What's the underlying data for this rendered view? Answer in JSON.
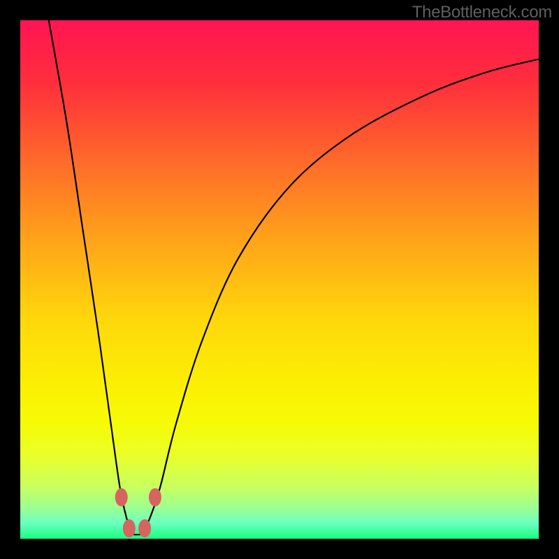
{
  "watermark": "TheBottleneck.com",
  "chart_data": {
    "type": "line",
    "title": "",
    "xlabel": "",
    "ylabel": "",
    "xlim": [
      0,
      100
    ],
    "ylim": [
      0,
      100
    ],
    "background_gradient": {
      "type": "linear-vertical",
      "stops": [
        {
          "pos": 0.0,
          "color": "#ff1553"
        },
        {
          "pos": 0.12,
          "color": "#ff2e3c"
        },
        {
          "pos": 0.28,
          "color": "#ff6d29"
        },
        {
          "pos": 0.42,
          "color": "#ffa21a"
        },
        {
          "pos": 0.58,
          "color": "#ffd80b"
        },
        {
          "pos": 0.72,
          "color": "#fbf203"
        },
        {
          "pos": 0.78,
          "color": "#f6fb06"
        },
        {
          "pos": 0.84,
          "color": "#eaff2a"
        },
        {
          "pos": 0.9,
          "color": "#c8ff60"
        },
        {
          "pos": 0.94,
          "color": "#9eff92"
        },
        {
          "pos": 0.97,
          "color": "#6affc0"
        },
        {
          "pos": 1.0,
          "color": "#18ff7e"
        }
      ]
    },
    "curve": {
      "description": "Asymmetric V-shaped bottleneck curve",
      "minimum_at_x": 22.5,
      "points": [
        {
          "x": 5.5,
          "y": 100.0
        },
        {
          "x": 9.0,
          "y": 80.0
        },
        {
          "x": 12.0,
          "y": 60.0
        },
        {
          "x": 15.0,
          "y": 40.0
        },
        {
          "x": 17.5,
          "y": 22.0
        },
        {
          "x": 19.2,
          "y": 10.0
        },
        {
          "x": 20.5,
          "y": 4.0
        },
        {
          "x": 21.5,
          "y": 1.2
        },
        {
          "x": 22.5,
          "y": 0.8
        },
        {
          "x": 23.5,
          "y": 1.2
        },
        {
          "x": 25.0,
          "y": 4.0
        },
        {
          "x": 27.0,
          "y": 10.0
        },
        {
          "x": 30.0,
          "y": 22.0
        },
        {
          "x": 35.0,
          "y": 38.0
        },
        {
          "x": 42.0,
          "y": 54.0
        },
        {
          "x": 52.0,
          "y": 68.0
        },
        {
          "x": 64.0,
          "y": 78.0
        },
        {
          "x": 78.0,
          "y": 85.5
        },
        {
          "x": 90.0,
          "y": 90.0
        },
        {
          "x": 100.0,
          "y": 92.5
        }
      ]
    },
    "markers": {
      "color": "#d6645f",
      "points": [
        {
          "x": 19.5,
          "y": 8.0
        },
        {
          "x": 26.0,
          "y": 8.0
        },
        {
          "x": 21.0,
          "y": 2.0
        },
        {
          "x": 24.0,
          "y": 2.0
        }
      ]
    }
  }
}
